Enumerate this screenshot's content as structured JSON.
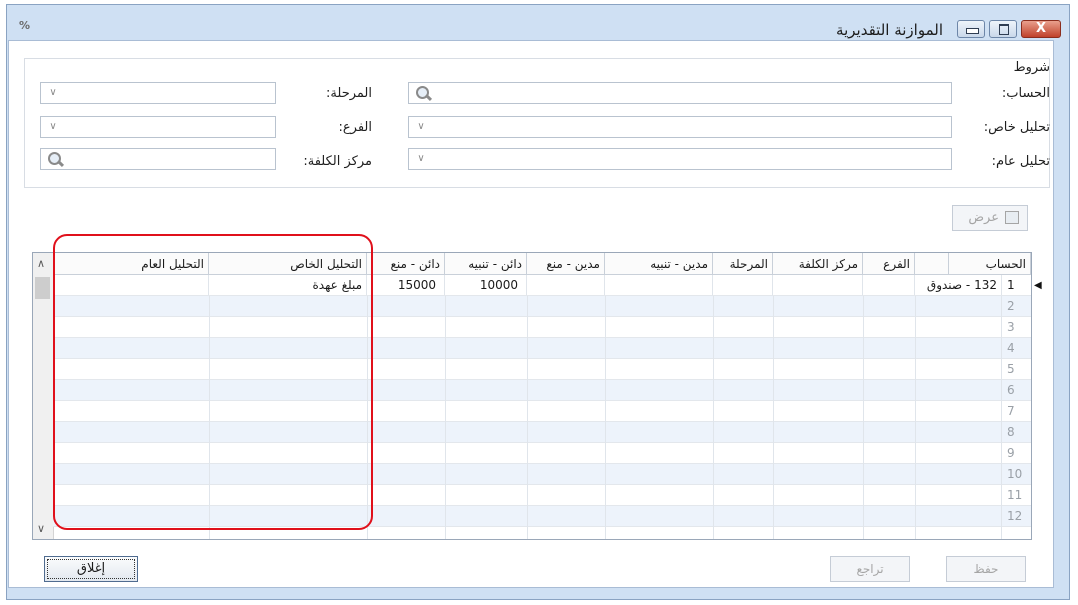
{
  "window": {
    "title": "الموازنة التقديرية",
    "close_symbol": "X"
  },
  "filters": {
    "section_title": "شروط",
    "account_label": "الحساب:",
    "special_analysis_label": "تحليل خاص:",
    "general_analysis_label": "تحليل عام:",
    "stage_label": "المرحلة:",
    "branch_label": "الفرع:",
    "cost_center_label": "مركز الكلفة:"
  },
  "toolbar": {
    "view_label": "عرض"
  },
  "grid": {
    "columns": [
      "الحساب",
      "الفرع",
      "مركز الكلفة",
      "المرحلة",
      "مدين - تنبيه",
      "مدين - منع",
      "دائن - تنبيه",
      "دائن - منع",
      "التحليل الخاص",
      "التحليل العام"
    ],
    "rows": [
      {
        "num": "1",
        "account": "132 - صندوق",
        "credit_alert": "10000",
        "credit_block": "15000",
        "special": "مبلغ عهدة"
      },
      {
        "num": "2"
      },
      {
        "num": "3"
      },
      {
        "num": "4"
      },
      {
        "num": "5"
      },
      {
        "num": "6"
      },
      {
        "num": "7"
      },
      {
        "num": "8"
      },
      {
        "num": "9"
      },
      {
        "num": "10"
      },
      {
        "num": "11"
      },
      {
        "num": "12"
      }
    ]
  },
  "footer": {
    "close_label": "إغلاق",
    "save_label": "حفظ",
    "undo_label": "تراجع"
  }
}
